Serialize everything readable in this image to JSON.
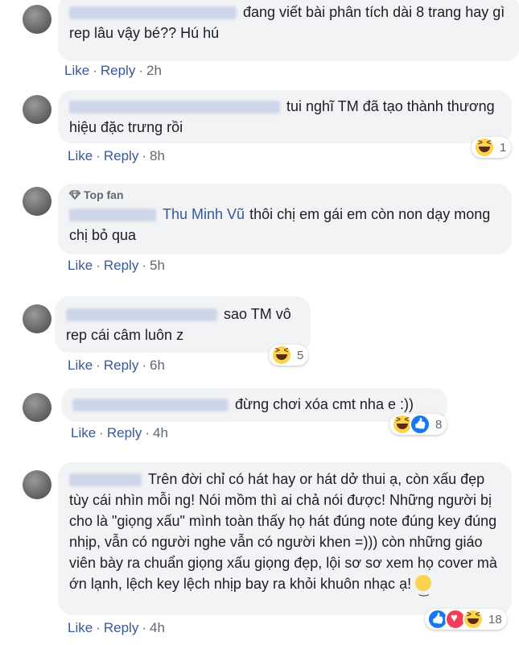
{
  "comments": [
    {
      "author_blurred": true,
      "text": "đang viết bài phân tích dài 8 trang hay gì rep lâu vậy bé?? Hú hú",
      "like": "Like",
      "reply": "Reply",
      "time": "2h"
    },
    {
      "author_blurred": true,
      "text": "tui nghĩ TM đã tạo thành thương hiệu đặc trưng rồi",
      "like": "Like",
      "reply": "Reply",
      "time": "8h",
      "reaction_count": "1"
    },
    {
      "author_blurred": true,
      "badge": "Top fan",
      "tag": "Thu Minh Vũ",
      "text": "thôi chị em gái em còn non dạy mong chị bỏ qua",
      "like": "Like",
      "reply": "Reply",
      "time": "5h"
    },
    {
      "author_blurred": true,
      "text": "sao TM vô rep cái câm luôn z",
      "like": "Like",
      "reply": "Reply",
      "time": "6h",
      "reaction_count": "5"
    },
    {
      "author_blurred": true,
      "text": "đừng chơi xóa cmt nha e :))",
      "like": "Like",
      "reply": "Reply",
      "time": "4h",
      "reaction_count": "8"
    },
    {
      "author_blurred": true,
      "text": "Trên đời chỉ có hát hay or hát dở thui ạ, còn xấu đẹp tùy cái nhìn mỗi ng! Nói mồm thì ai chả nói được! Những người bị cho là \"giọng xấu\" mình toàn thấy họ hát đúng note đúng key đúng nhịp, vẫn có người nghe vẫn có người khen =))) còn những giáo viên bày ra chuẩn giọng xấu giọng đẹp, lội sơ sơ xem họ cover mà ớn lạnh, lệch key lệch nhịp bay ra khỏi khuôn nhạc ạ!",
      "like": "Like",
      "reply": "Reply",
      "time": "4h",
      "reaction_count": "18"
    }
  ],
  "icons": {
    "haha": "haha-react-icon",
    "like": "like-react-icon",
    "love": "love-react-icon",
    "gem": "top-fan-gem-icon",
    "wink": "wink-emoji-icon"
  },
  "colors": {
    "bubble": "#f2f3f5",
    "link": "#385898",
    "meta": "#606770"
  }
}
